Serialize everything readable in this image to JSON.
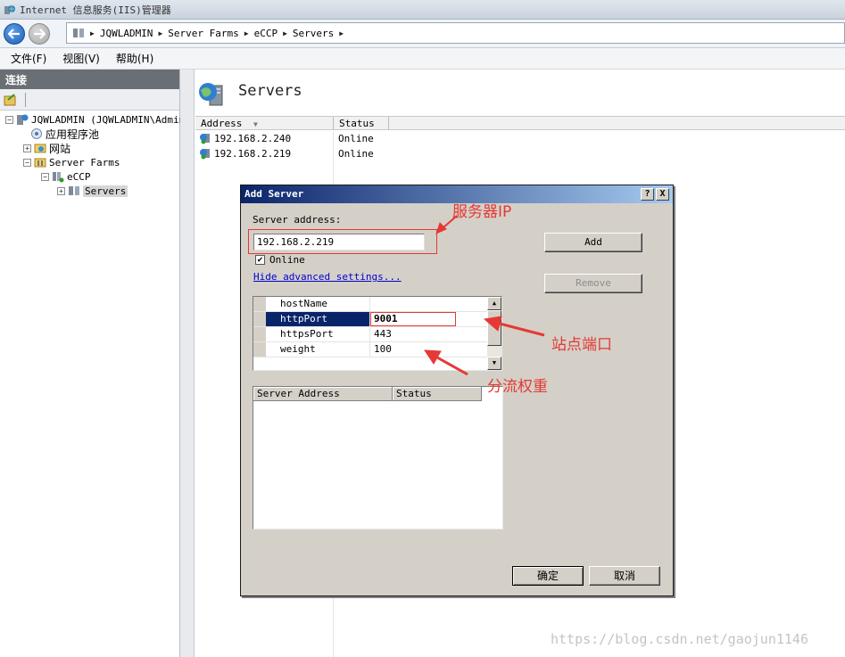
{
  "window": {
    "title": "Internet 信息服务(IIS)管理器"
  },
  "breadcrumb": [
    "JQWLADMIN",
    "Server Farms",
    "eCCP",
    "Servers"
  ],
  "menu": [
    "文件(F)",
    "视图(V)",
    "帮助(H)"
  ],
  "connections": {
    "header": "连接",
    "tree": [
      {
        "label": "JQWLADMIN (JQWLADMIN\\Admin"
      },
      {
        "label": "应用程序池"
      },
      {
        "label": "网站"
      },
      {
        "label": "Server Farms"
      },
      {
        "label": "eCCP"
      },
      {
        "label": "Servers"
      }
    ]
  },
  "main": {
    "title": "Servers",
    "columns": {
      "address": "Address",
      "status": "Status"
    },
    "rows": [
      {
        "address": "192.168.2.240",
        "status": "Online"
      },
      {
        "address": "192.168.2.219",
        "status": "Online"
      }
    ]
  },
  "dialog": {
    "title": "Add Server",
    "help_button": "?",
    "close_button": "X",
    "server_address_label": "Server address:",
    "server_address_value": "192.168.2.219",
    "online_label": "Online",
    "online_checked": true,
    "advanced_link": "Hide advanced settings...",
    "add_button": "Add",
    "remove_button": "Remove",
    "properties": [
      {
        "name": "hostName",
        "value": ""
      },
      {
        "name": "httpPort",
        "value": "9001"
      },
      {
        "name": "httpsPort",
        "value": "443"
      },
      {
        "name": "weight",
        "value": "100"
      }
    ],
    "server_list_columns": {
      "address": "Server Address",
      "status": "Status"
    },
    "ok_button": "确定",
    "cancel_button": "取消"
  },
  "annotations": {
    "server_ip": "服务器IP",
    "site_port": "站点端口",
    "load_weight": "分流权重",
    "color": "#e53935"
  },
  "watermark": "https://blog.csdn.net/gaojun1146"
}
